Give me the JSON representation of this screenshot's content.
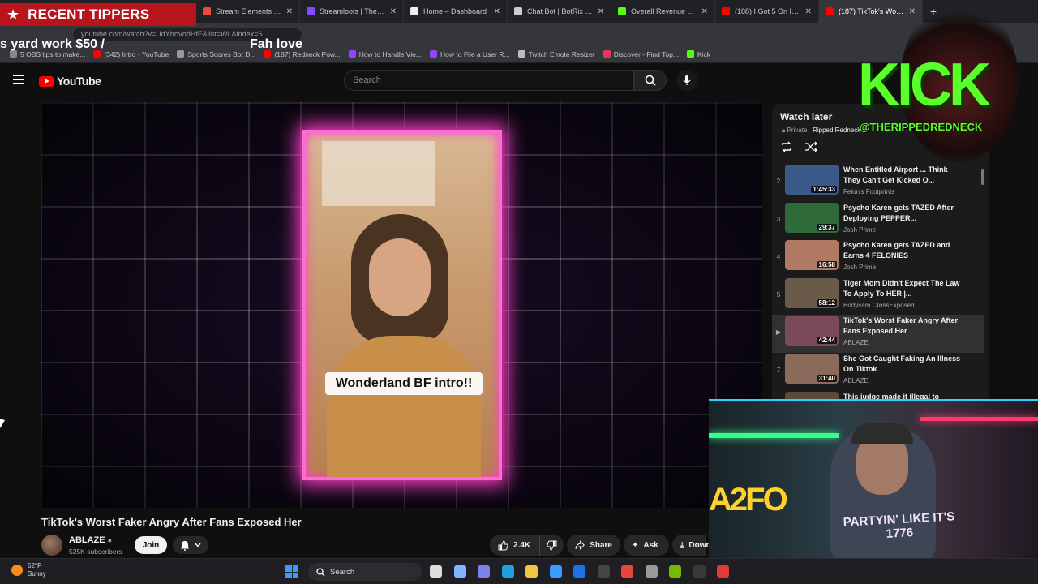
{
  "browser": {
    "tabs": [
      {
        "label": "Stream Elements - Tipi",
        "color": "#e74c3c"
      },
      {
        "label": "Streamloots | Therippe",
        "color": "#7c4dff"
      },
      {
        "label": "Home – Dashboard",
        "color": "#eeeeee"
      },
      {
        "label": "Chat Bot | BotRix — Cl",
        "color": "#cccccc"
      },
      {
        "label": "Overall Revenue - Kick",
        "color": "#53fc18"
      },
      {
        "label": "(188) I Got 5 On It - Yo",
        "color": "#ff0000"
      },
      {
        "label": "(187) TikTok's Worst Fa",
        "color": "#ff0000",
        "active": true
      }
    ],
    "url": "youtube.com/watch?v=UdYhcVodHfE&list=WL&index=6",
    "bookmarks": [
      {
        "label": "5 OBS tips to make...",
        "color": "#888888"
      },
      {
        "label": "(342) Intro - YouTube",
        "color": "#ff0000"
      },
      {
        "label": "Sports Scores Bot D...",
        "color": "#999999"
      },
      {
        "label": "(187) Redneck Pow...",
        "color": "#ff0000"
      },
      {
        "label": "How to Handle Vie...",
        "color": "#9146ff"
      },
      {
        "label": "How to File a User R...",
        "color": "#9146ff"
      },
      {
        "label": "Twitch Emote Resizer",
        "color": "#bbbbbb"
      },
      {
        "label": "Discover - Find Top...",
        "color": "#e2365b"
      },
      {
        "label": "Kick",
        "color": "#53fc18"
      }
    ]
  },
  "overlay": {
    "tippers_title": "RECENT TIPPERS",
    "ticker_left": "s yard work $50 /",
    "ticker_right": "Fah love",
    "kick_logo": "KICK",
    "kick_handle": "@THERIPPEDREDNECK",
    "webcam_sign": "A2FO",
    "shirt_text": "PARTYIN' LIKE IT'S 1776"
  },
  "youtube": {
    "brand": "YouTube",
    "search_placeholder": "Search",
    "video_caption": "Wonderland BF intro!!",
    "video_title": "TikTok's Worst Faker Angry After Fans Exposed Her",
    "channel": {
      "name": "ABLAZE",
      "subscribers": "525K subscribers"
    },
    "join_label": "Join",
    "actions": {
      "likes": "2.4K",
      "share": "Share",
      "ask": "Ask",
      "download": "Down"
    }
  },
  "watch_later": {
    "title": "Watch later",
    "privacy": "Private",
    "owner": "Ripped Redneck",
    "items": [
      {
        "index": "2",
        "title": "When Entitled Airport ... Think They Can't Get Kicked O...",
        "channel": "Felon's Footprints",
        "duration": "1:45:33",
        "thumb": "#3a5a8a",
        "active": false
      },
      {
        "index": "3",
        "title": "Psycho Karen gets TAZED After Deploying PEPPER...",
        "channel": "Josh Prime",
        "duration": "29:37",
        "thumb": "#2f6b3a",
        "active": false
      },
      {
        "index": "4",
        "title": "Psycho Karen gets TAZED and Earns 4 FELONIES",
        "channel": "Josh Prime",
        "duration": "16:58",
        "thumb": "#b07a62",
        "active": false
      },
      {
        "index": "5",
        "title": "Tiger Mom Didn't Expect The Law To Apply To HER |...",
        "channel": "Bodycam CrossExposed",
        "duration": "58:12",
        "thumb": "#6a5a4a",
        "active": false
      },
      {
        "index": "▶",
        "title": "TikTok's Worst Faker Angry After Fans Exposed Her",
        "channel": "ABLAZE",
        "duration": "42:44",
        "thumb": "#7a4a5a",
        "active": true
      },
      {
        "index": "7",
        "title": "She Got Caught Faking An Illness On Tiktok",
        "channel": "ABLAZE",
        "duration": "31:40",
        "thumb": "#8a6a5a",
        "active": false
      },
      {
        "index": "",
        "title": "This judge made it illegal to",
        "channel": "",
        "duration": "",
        "thumb": "#5a4a3a",
        "active": false
      }
    ]
  },
  "taskbar": {
    "temp": "62°F",
    "condition": "Sunny",
    "search_label": "Search",
    "apps": [
      {
        "name": "task-view-icon",
        "color": "#dddddd"
      },
      {
        "name": "copilot-icon",
        "color": "#7fb6ff"
      },
      {
        "name": "teams-icon",
        "color": "#7b83eb"
      },
      {
        "name": "edge-icon",
        "color": "#1fa0e0"
      },
      {
        "name": "folder-icon",
        "color": "#f5c542"
      },
      {
        "name": "store-icon",
        "color": "#3b9cff"
      },
      {
        "name": "outlook-icon",
        "color": "#1a73e8"
      },
      {
        "name": "obs-icon",
        "color": "#444444"
      },
      {
        "name": "chrome-icon",
        "color": "#e8453c"
      },
      {
        "name": "app-icon",
        "color": "#999999"
      },
      {
        "name": "nvidia-icon",
        "color": "#76b900"
      },
      {
        "name": "app2-icon",
        "color": "#3a3a3a"
      },
      {
        "name": "app3-icon",
        "color": "#e03a3a"
      }
    ]
  }
}
